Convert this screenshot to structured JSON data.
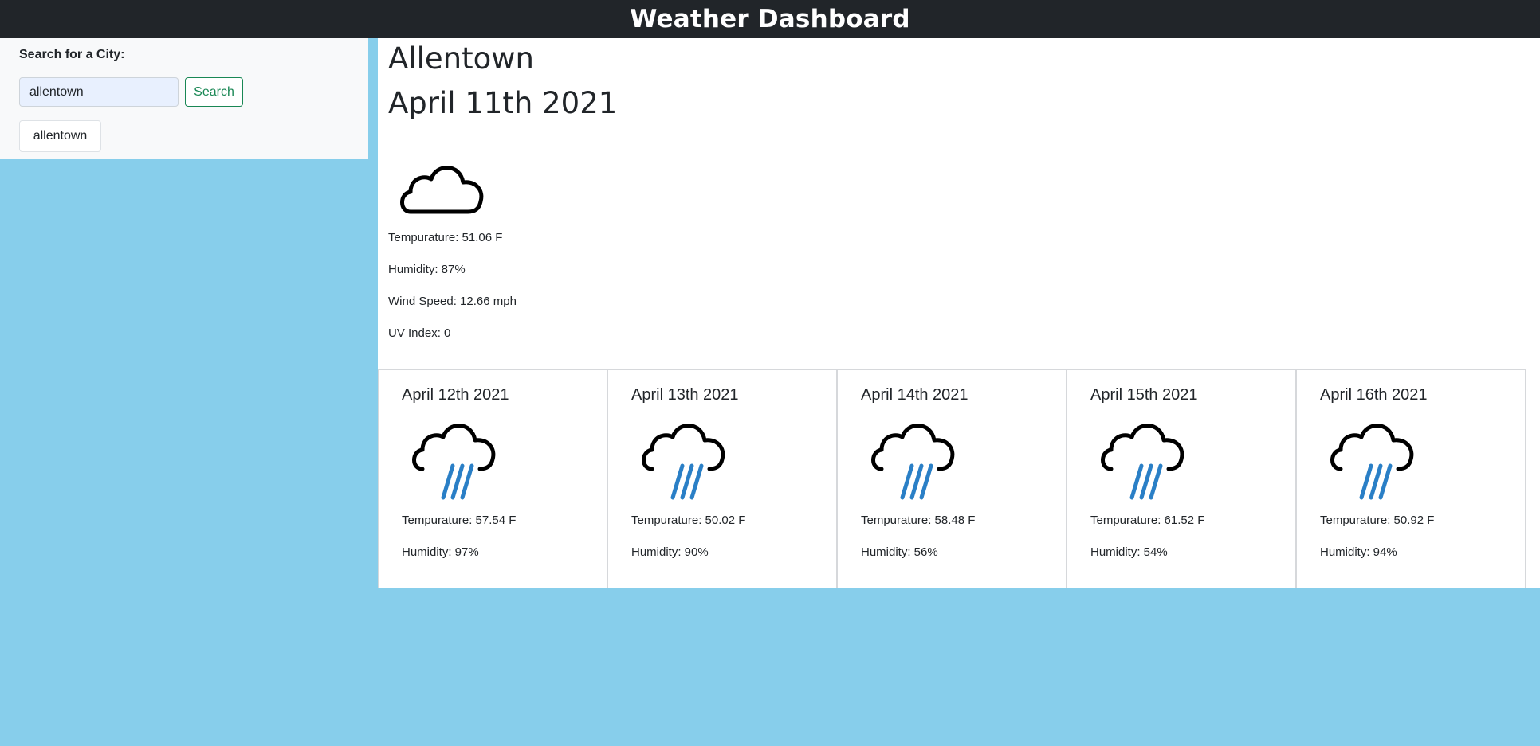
{
  "header": {
    "title": "Weather Dashboard"
  },
  "sidebar": {
    "label": "Search for a City:",
    "search_value": "allentown",
    "search_button": "Search",
    "history": [
      "allentown"
    ]
  },
  "current": {
    "city": "Allentown",
    "date": "April 11th 2021",
    "icon": "cloud-icon",
    "temperature": "Tempurature: 51.06 F",
    "humidity": "Humidity: 87%",
    "wind": "Wind Speed: 12.66 mph",
    "uv": "UV Index: 0"
  },
  "forecast": [
    {
      "date": "April 12th 2021",
      "icon": "rain-icon",
      "temperature": "Tempurature: 57.54 F",
      "humidity": "Humidity: 97%"
    },
    {
      "date": "April 13th 2021",
      "icon": "rain-icon",
      "temperature": "Tempurature: 50.02 F",
      "humidity": "Humidity: 90%"
    },
    {
      "date": "April 14th 2021",
      "icon": "rain-icon",
      "temperature": "Tempurature: 58.48 F",
      "humidity": "Humidity: 56%"
    },
    {
      "date": "April 15th 2021",
      "icon": "rain-icon",
      "temperature": "Tempurature: 61.52 F",
      "humidity": "Humidity: 54%"
    },
    {
      "date": "April 16th 2021",
      "icon": "rain-icon",
      "temperature": "Tempurature: 50.92 F",
      "humidity": "Humidity: 94%"
    }
  ],
  "colors": {
    "page_background": "#87ceeb",
    "header_background": "#212529",
    "sidebar_background": "#f8f9fa",
    "search_button_border": "#198754",
    "rain_color": "#2a7fc6"
  }
}
